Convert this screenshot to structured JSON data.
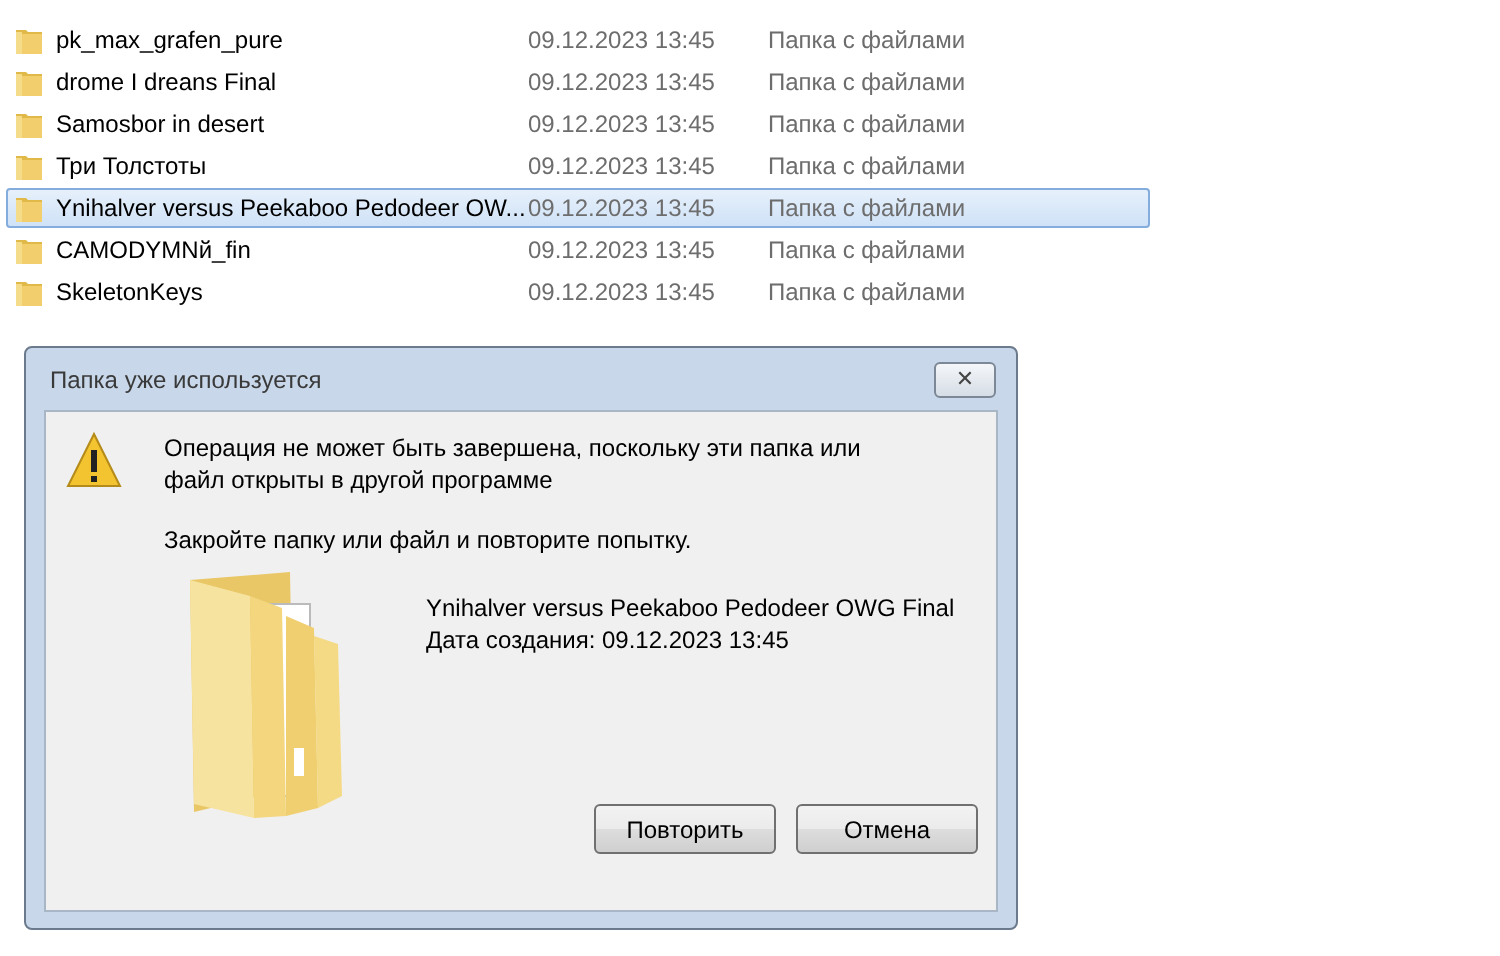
{
  "folders": [
    {
      "name": "pk_max_grafen_pure",
      "date": "09.12.2023 13:45",
      "type": "Папка с файлами",
      "selected": false
    },
    {
      "name": "drome I dreans Final",
      "date": "09.12.2023 13:45",
      "type": "Папка с файлами",
      "selected": false
    },
    {
      "name": "Samosbor in desert",
      "date": "09.12.2023 13:45",
      "type": "Папка с файлами",
      "selected": false
    },
    {
      "name": "Три Толстоты",
      "date": "09.12.2023 13:45",
      "type": "Папка с файлами",
      "selected": false
    },
    {
      "name": "Ynihalver versus Peekaboo Pedodeer OW...",
      "date": "09.12.2023 13:45",
      "type": "Папка с файлами",
      "selected": true
    },
    {
      "name": "CAMODYMNй_fin",
      "date": "09.12.2023 13:45",
      "type": "Папка с файлами",
      "selected": false
    },
    {
      "name": "SkeletonKeys",
      "date": "09.12.2023 13:45",
      "type": "Папка с файлами",
      "selected": false
    }
  ],
  "dialog": {
    "title": "Папка уже используется",
    "close": "✕",
    "message": "Операция не может быть завершена, поскольку эти папка или файл открыты в другой программе",
    "hint": "Закройте папку или файл и повторите попытку.",
    "file_name": "Ynihalver versus Peekaboo Pedodeer OWG Final",
    "created": "Дата создания: 09.12.2023 13:45",
    "buttons": [
      "Повторить",
      "Отмена"
    ]
  }
}
